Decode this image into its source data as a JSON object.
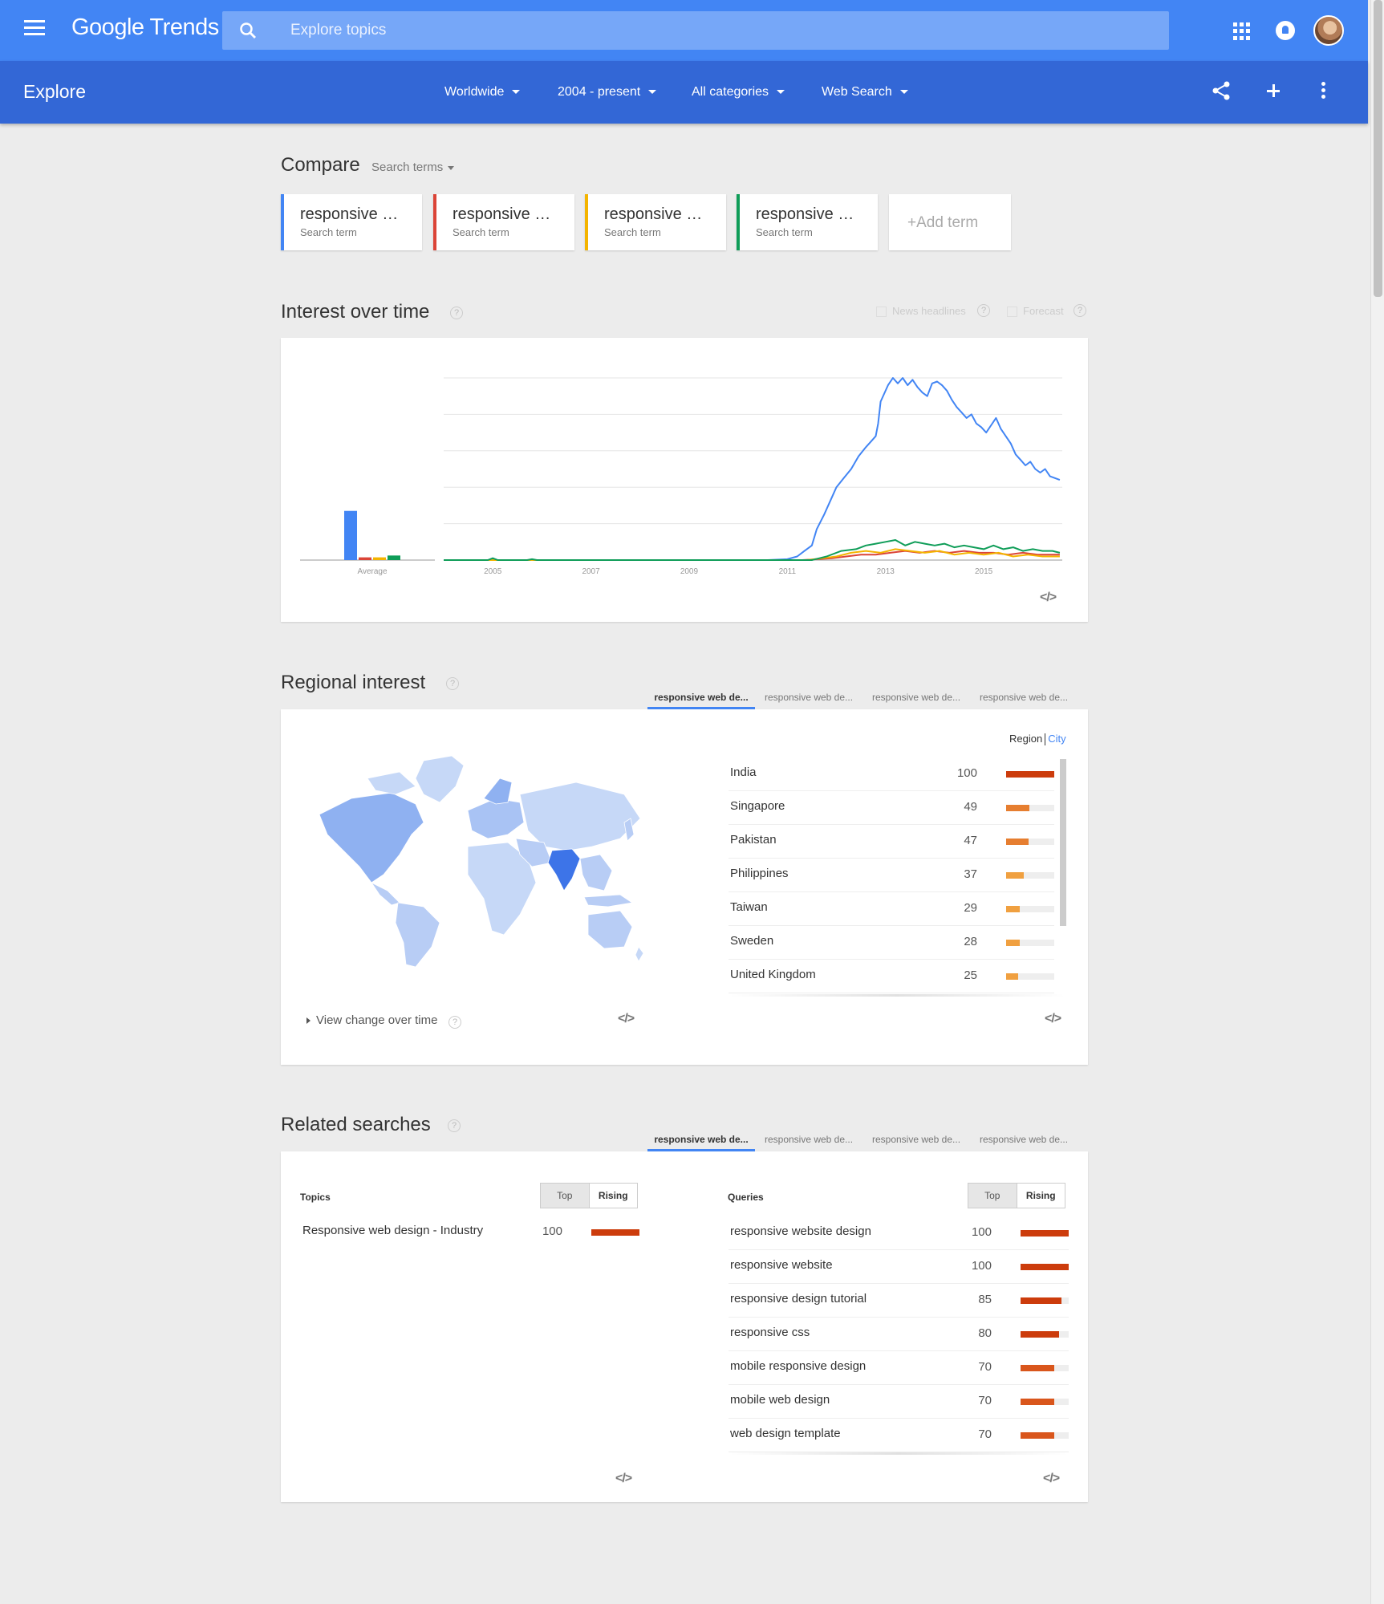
{
  "app": {
    "logo": "Google Trends"
  },
  "search": {
    "placeholder": "Explore topics"
  },
  "explore": {
    "title": "Explore",
    "filters": [
      "Worldwide",
      "2004 - present",
      "All categories",
      "Web Search"
    ]
  },
  "compare": {
    "title": "Compare",
    "dropdown": "Search terms",
    "terms": [
      {
        "label": "responsive web design",
        "sub": "Search term",
        "color": "#4285f4"
      },
      {
        "label": "responsive web design",
        "sub": "Search term",
        "color": "#db4437"
      },
      {
        "label": "responsive web design",
        "sub": "Search term",
        "color": "#f4b400"
      },
      {
        "label": "responsive web design",
        "sub": "Search term",
        "color": "#0f9d58"
      }
    ],
    "add_term": "+Add term"
  },
  "interest": {
    "title": "Interest over time",
    "help": "?",
    "news_headlines": "News headlines",
    "forecast": "Forecast",
    "embed": "</>"
  },
  "chart_data": {
    "type": "line",
    "x_ticks": [
      "2005",
      "2007",
      "2009",
      "2011",
      "2013",
      "2015"
    ],
    "average_label": "Average",
    "averages": [
      {
        "color": "#4285f4",
        "value": 27
      },
      {
        "color": "#db4437",
        "value": 1.5
      },
      {
        "color": "#f4b400",
        "value": 1.5
      },
      {
        "color": "#0f9d58",
        "value": 2.5
      }
    ],
    "ylim": [
      0,
      100
    ],
    "grid": true,
    "series": [
      {
        "color": "#4285f4",
        "x": [
          2004.0,
          2004.9,
          2005.0,
          2005.1,
          2005.8,
          2006.0,
          2010.6,
          2011.0,
          2011.2,
          2011.35,
          2011.5,
          2011.6,
          2011.75,
          2011.9,
          2012.0,
          2012.15,
          2012.3,
          2012.45,
          2012.6,
          2012.7,
          2012.8,
          2012.85,
          2012.9,
          2013.05,
          2013.15,
          2013.25,
          2013.35,
          2013.45,
          2013.55,
          2013.65,
          2013.75,
          2013.85,
          2013.95,
          2014.05,
          2014.15,
          2014.25,
          2014.35,
          2014.45,
          2014.55,
          2014.65,
          2014.75,
          2014.85,
          2014.95,
          2015.05,
          2015.15,
          2015.25,
          2015.35,
          2015.45,
          2015.55,
          2015.65,
          2015.75,
          2015.85,
          2015.95,
          2016.05,
          2016.15,
          2016.25,
          2016.35,
          2016.45,
          2016.55
        ],
        "y": [
          0,
          0,
          1,
          0,
          0,
          0,
          0,
          0.5,
          2,
          5,
          8,
          17,
          25,
          34,
          40,
          45,
          50,
          57,
          62,
          65,
          68,
          75,
          87,
          96,
          100,
          97,
          100,
          96,
          99,
          95,
          92,
          90,
          97,
          98,
          96,
          93,
          88,
          84,
          81,
          78,
          80,
          75,
          73,
          70,
          74,
          78,
          72,
          68,
          64,
          58,
          55,
          52,
          54,
          50,
          48,
          50,
          46,
          45,
          44
        ]
      },
      {
        "color": "#db4437",
        "x": [
          2004.0,
          2011.3,
          2011.6,
          2011.9,
          2012.2,
          2012.5,
          2012.8,
          2013.1,
          2013.4,
          2013.7,
          2014.0,
          2014.3,
          2014.6,
          2014.9,
          2015.2,
          2015.5,
          2015.8,
          2016.1,
          2016.4,
          2016.55
        ],
        "y": [
          0,
          0,
          0.5,
          1,
          2,
          3,
          3,
          4,
          5,
          4,
          5,
          4,
          5,
          4,
          4,
          3,
          4,
          3,
          3,
          3
        ]
      },
      {
        "color": "#f4b400",
        "x": [
          2004.0,
          2011.4,
          2011.7,
          2012.0,
          2012.3,
          2012.6,
          2012.9,
          2013.2,
          2013.5,
          2013.8,
          2014.1,
          2014.4,
          2014.7,
          2015.0,
          2015.3,
          2015.6,
          2015.9,
          2016.2,
          2016.55
        ],
        "y": [
          0,
          0,
          1,
          2,
          4,
          5,
          4,
          6,
          5,
          4,
          5,
          3,
          4,
          3,
          4,
          2,
          3,
          2,
          2
        ]
      },
      {
        "color": "#0f9d58",
        "x": [
          2004.0,
          2004.9,
          2005.0,
          2005.1,
          2005.7,
          2005.8,
          2005.9,
          2011.5,
          2011.8,
          2012.1,
          2012.4,
          2012.6,
          2012.8,
          2013.0,
          2013.2,
          2013.4,
          2013.6,
          2013.8,
          2014.0,
          2014.2,
          2014.4,
          2014.6,
          2014.8,
          2015.0,
          2015.2,
          2015.4,
          2015.6,
          2015.8,
          2016.0,
          2016.2,
          2016.4,
          2016.55
        ],
        "y": [
          0,
          0,
          1,
          0,
          0,
          0.5,
          0,
          0,
          2,
          5,
          6,
          8,
          9,
          10,
          11,
          8,
          10,
          9,
          8,
          9,
          7,
          8,
          7,
          6,
          8,
          6,
          7,
          5,
          6,
          5,
          5,
          4
        ]
      }
    ]
  },
  "regional": {
    "title": "Regional interest",
    "tabs": [
      "responsive web de...",
      "responsive web de...",
      "responsive web de...",
      "responsive web de..."
    ],
    "region_label": "Region",
    "city_label": "City",
    "rows": [
      {
        "name": "India",
        "value": 100,
        "color": "#cc3c0c"
      },
      {
        "name": "Singapore",
        "value": 49,
        "color": "#e67e30"
      },
      {
        "name": "Pakistan",
        "value": 47,
        "color": "#e67e30"
      },
      {
        "name": "Philippines",
        "value": 37,
        "color": "#f0a040"
      },
      {
        "name": "Taiwan",
        "value": 29,
        "color": "#f0a040"
      },
      {
        "name": "Sweden",
        "value": 28,
        "color": "#f0a040"
      },
      {
        "name": "United Kingdom",
        "value": 25,
        "color": "#f0a040"
      }
    ],
    "view_change": "View change over time",
    "embed": "</>"
  },
  "related": {
    "title": "Related searches",
    "tabs": [
      "responsive web de...",
      "responsive web de...",
      "responsive web de...",
      "responsive web de..."
    ],
    "topics_title": "Topics",
    "queries_title": "Queries",
    "toggle_top": "Top",
    "toggle_rising": "Rising",
    "topics": [
      {
        "name": "Responsive web design - Industry",
        "value": 100,
        "color": "#cc3c0c"
      }
    ],
    "queries": [
      {
        "name": "responsive website design",
        "value": 100,
        "color": "#cc3c0c"
      },
      {
        "name": "responsive website",
        "value": 100,
        "color": "#cc3c0c"
      },
      {
        "name": "responsive design tutorial",
        "value": 85,
        "color": "#cc3c0c"
      },
      {
        "name": "responsive css",
        "value": 80,
        "color": "#cc3c0c"
      },
      {
        "name": "mobile responsive design",
        "value": 70,
        "color": "#d9561c"
      },
      {
        "name": "mobile web design",
        "value": 70,
        "color": "#d9561c"
      },
      {
        "name": "web design template",
        "value": 70,
        "color": "#d9561c"
      }
    ],
    "embed": "</>"
  }
}
